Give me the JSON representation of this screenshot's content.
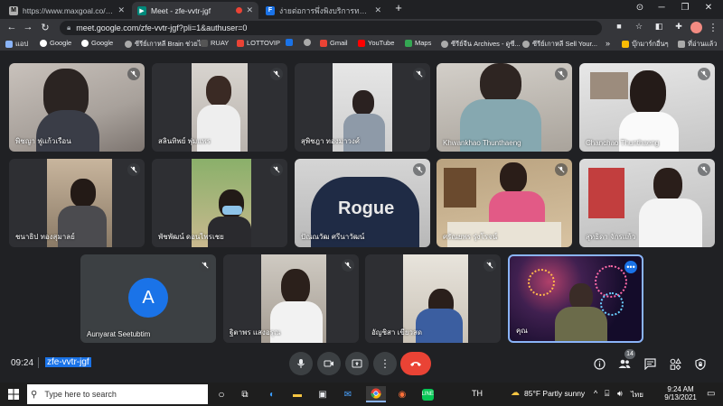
{
  "browser": {
    "tabs": [
      {
        "label": "https://www.maxgoal.co/th/regi",
        "active": false
      },
      {
        "label": "Meet - zfe-vvtr-jgf",
        "active": true
      },
      {
        "label": "ง่ายต่อการพึ่งพิงบริการทางอินเตอร์เน็ต",
        "active": false
      }
    ],
    "url": "meet.google.com/zfe-vvtr-jgf?pli=1&authuser=0",
    "bookmarks": [
      "แอป",
      "Google",
      "Google",
      "ซีรีย์เกาหลี Brain ช่วยไ...",
      "RUAY",
      "LOTTOVIP",
      "",
      "",
      "Gmail",
      "YouTube",
      "Maps",
      "ซีรีย์จีน Archives - ดูซี...",
      "ซีรีย์เกาหลี Sell Your...",
      "บุ๊กมาร์กอื่นๆ",
      "ที่อ่านแล้ว"
    ]
  },
  "participants": [
    {
      "name": "พิชญา ฟูแก้วเรือน",
      "muted": true
    },
    {
      "name": "สลินทิพย์ พุ่มแพร",
      "muted": true
    },
    {
      "name": "สุพิชฎา ทองมาวงศ์",
      "muted": true
    },
    {
      "name": "Khwankhao Thunthaeng",
      "muted": true
    },
    {
      "name": "Chanchao Thunthaeng",
      "muted": true
    },
    {
      "name": "ชนาธิป ทองสุมาลย์",
      "muted": true
    },
    {
      "name": "พัชพัฒน์ ดอนไพรเชย",
      "muted": true
    },
    {
      "name": "ปัณณวัฒ ศรีนาวัฒน์",
      "muted": true
    },
    {
      "name": "ศรัณยพร รุ่งโรจน์",
      "muted": true
    },
    {
      "name": "สุทธิดา จักรแก้ว",
      "muted": true
    },
    {
      "name": "Aunyarat Seetubtim",
      "muted": true,
      "avatar": "A"
    },
    {
      "name": "ฐิตาพร แสงอรุณ",
      "muted": true
    },
    {
      "name": "อัญชิสา เขียวสด",
      "muted": true
    },
    {
      "name": "คุณ",
      "muted": false
    }
  ],
  "meeting": {
    "time": "09:24",
    "code": "zfe-vvtr-jgf",
    "participant_count": "14"
  },
  "taskbar": {
    "search_placeholder": "Type here to search",
    "language": "TH",
    "weather": "85°F  Partly sunny",
    "tray_lang": "ไทย",
    "clock_time": "9:24 AM",
    "clock_date": "9/13/2021"
  },
  "colors": {
    "accent": "#8ab4f8",
    "end_call": "#ea4335",
    "avatar": "#1a73e8",
    "badge": "#5f6368"
  }
}
